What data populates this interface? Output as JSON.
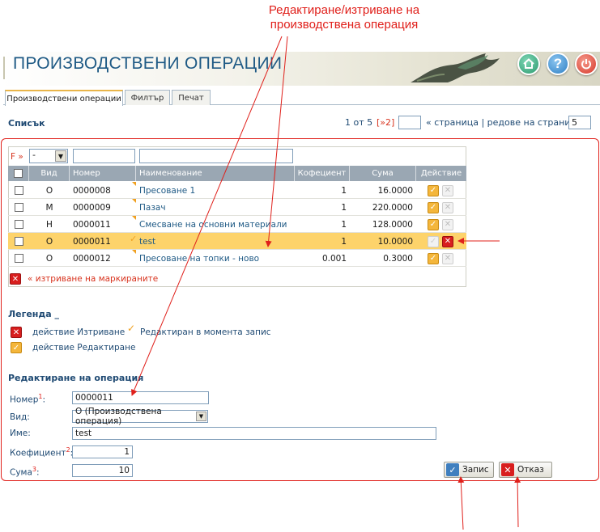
{
  "annotation": {
    "title_line1": "Редактиране/изтриване на",
    "title_line2": "производствена операция"
  },
  "header": {
    "title": "ПРОИЗВОДСТВЕНИ ОПЕРАЦИИ",
    "buttons": [
      "home-icon",
      "help-icon",
      "power-icon"
    ],
    "help_glyph": "?"
  },
  "tabs": [
    {
      "label": "Производствени операции",
      "active": true
    },
    {
      "label": "Филтър",
      "active": false
    },
    {
      "label": "Печат",
      "active": false
    }
  ],
  "list": {
    "title": "Списък",
    "pager": {
      "info": "1 от 5",
      "next": "[»2]",
      "page_value": "",
      "link_text": "« страница | редове на страница »",
      "rows_per_page": "5"
    }
  },
  "table": {
    "filter_label": "F »",
    "filter_select_value": "-",
    "headers": [
      "Вид",
      "Номер",
      "Наименование",
      "Кофециент",
      "Сума",
      "Действие"
    ],
    "rows": [
      {
        "type": "О",
        "number": "0000008",
        "name": "Пресоване 1",
        "coef": "1",
        "sum": "16.0000",
        "selected": false
      },
      {
        "type": "М",
        "number": "0000009",
        "name": "Пазач",
        "coef": "1",
        "sum": "220.0000",
        "selected": false
      },
      {
        "type": "Н",
        "number": "0000011",
        "name": "Смесване на основни материали",
        "coef": "1",
        "sum": "128.0000",
        "selected": false
      },
      {
        "type": "О",
        "number": "0000011",
        "name": "test",
        "coef": "1",
        "sum": "10.0000",
        "selected": true
      },
      {
        "type": "О",
        "number": "0000012",
        "name": "Пресоване на топки - ново",
        "coef": "0.001",
        "sum": "0.3000",
        "selected": false
      }
    ],
    "bulk_delete_label": "« изтриване на маркираните"
  },
  "legend": {
    "title": "Легенда _",
    "delete_label": "действие Изтриване",
    "edit_label": "действие Редактиране",
    "edited_label": "Редактиран в момента запис"
  },
  "form": {
    "title": "Редактиране на операция",
    "number_label": "Номер",
    "number_sup": "1",
    "number_value": "0000011",
    "type_label": "Вид:",
    "type_value": "О (Производствена операция)",
    "name_label": "Име:",
    "name_value": "test",
    "coef_label": "Коефициент",
    "coef_sup": "2",
    "coef_value": "1",
    "sum_label": "Сума",
    "sum_sup": "3",
    "sum_value": "10",
    "save_label": "Запис",
    "cancel_label": "Отказ"
  },
  "colors": {
    "accent": "#1f5a85",
    "annotation_red": "#e0201b",
    "selected_row": "#fdd36b",
    "header_bg": "#9aa7b3"
  }
}
